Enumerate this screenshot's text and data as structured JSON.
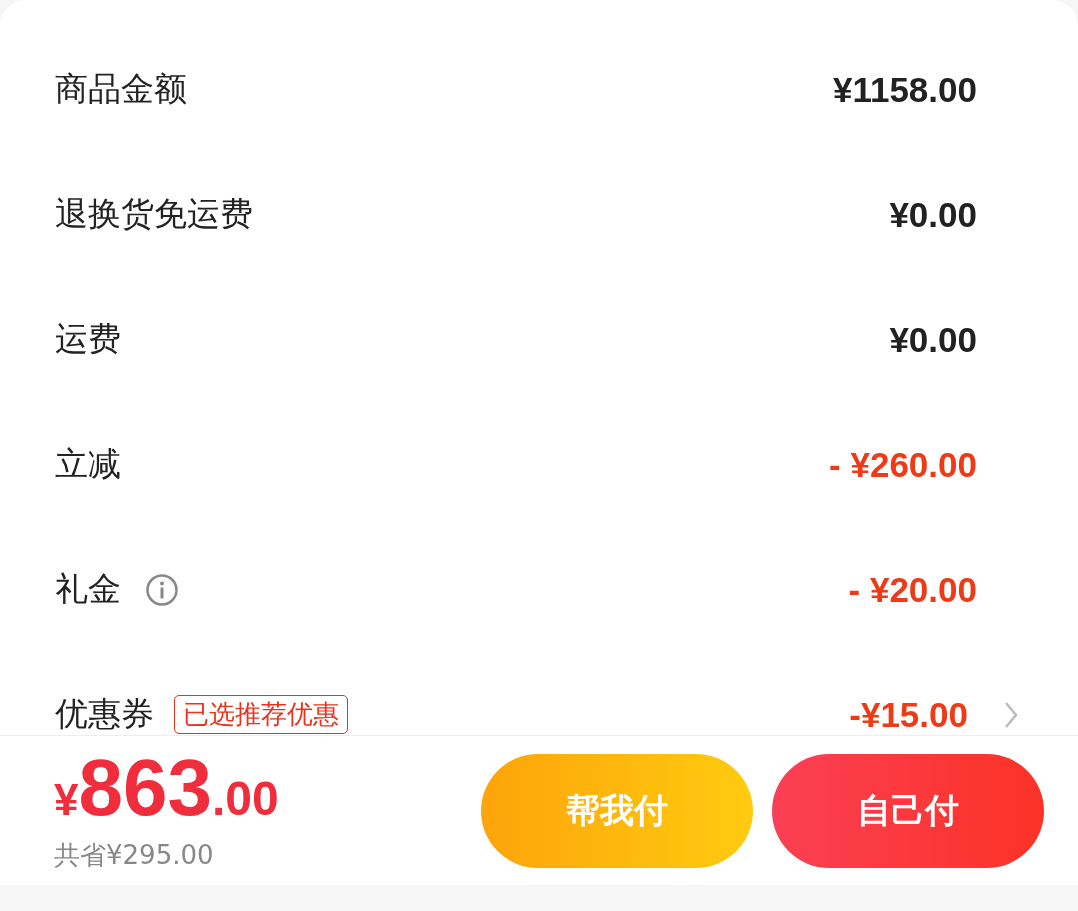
{
  "rows": [
    {
      "label": "商品金额",
      "value": "¥1158.00",
      "kind": "normal"
    },
    {
      "label": "退换货免运费",
      "value": "¥0.00",
      "kind": "normal"
    },
    {
      "label": "运费",
      "value": "¥0.00",
      "kind": "normal"
    },
    {
      "label": "立减",
      "value": "- ¥260.00",
      "kind": "discount"
    },
    {
      "label": "礼金",
      "value": "- ¥20.00",
      "kind": "discount",
      "info": true
    },
    {
      "label": "优惠券",
      "tag": "已选推荐优惠",
      "value": "-¥15.00",
      "kind": "discount",
      "link": true
    }
  ],
  "footer": {
    "currency": "¥",
    "price_integer": "863",
    "price_decimal": ".00",
    "saved": "共省¥295.00",
    "buttons": [
      {
        "label": "帮我付",
        "kind": "friend"
      },
      {
        "label": "自己付",
        "kind": "self"
      }
    ]
  }
}
